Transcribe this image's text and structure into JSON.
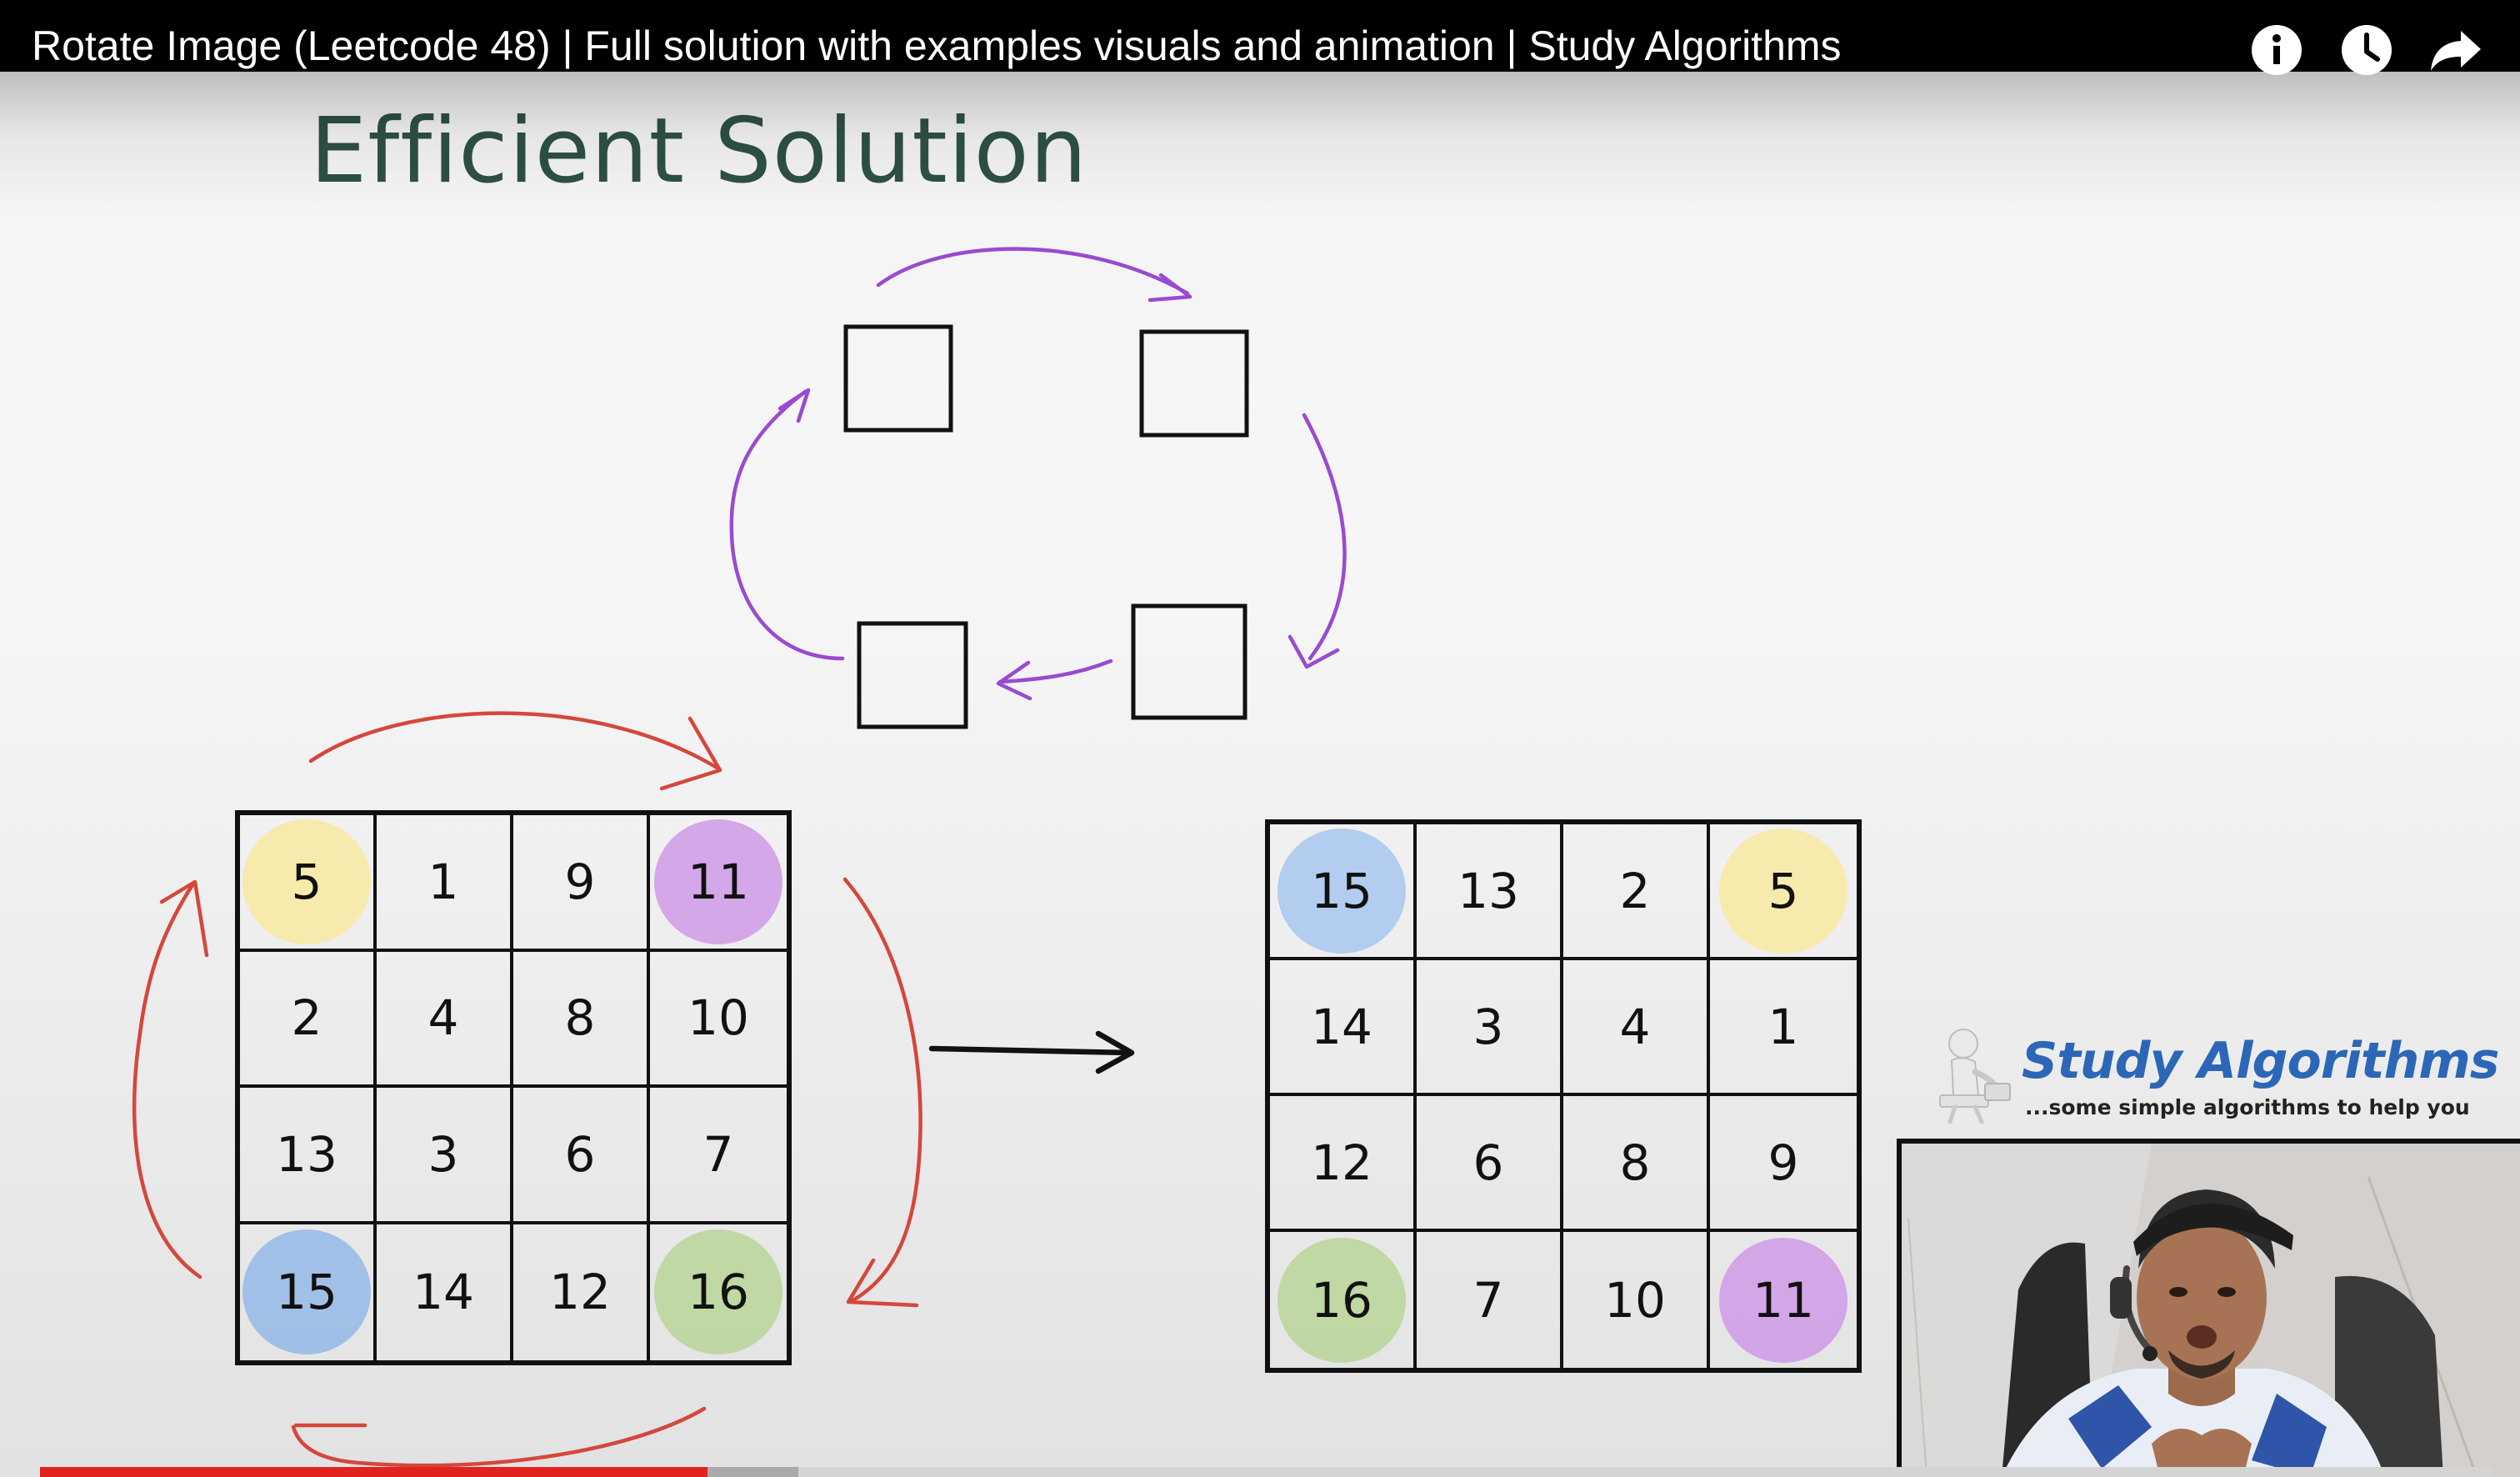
{
  "video": {
    "title": "Rotate Image (Leetcode 48) | Full solution with examples visuals and animation | Study Algorithms",
    "progress": 0.272,
    "buffered": 0.309,
    "played_color": "#e0231e",
    "buffered_color": "#a9a9a9",
    "unplayed_color": "#d4d4d4"
  },
  "controls": {
    "info_icon": "info-icon",
    "watch_later_icon": "clock-icon",
    "share_icon": "share-arrow-icon"
  },
  "slide": {
    "title": "Efficient Solution",
    "title_color": "#2e5145",
    "arrow_colors": {
      "top_cycle": "#9a4ad1",
      "matrix_cycle": "#d5473b",
      "transform_arrow": "#111111"
    },
    "original_matrix": [
      [
        {
          "value": "5",
          "highlight": "#f8e9a1"
        },
        {
          "value": "1"
        },
        {
          "value": "9"
        },
        {
          "value": "11",
          "highlight": "#cf9ae6"
        }
      ],
      [
        {
          "value": "2"
        },
        {
          "value": "4"
        },
        {
          "value": "8"
        },
        {
          "value": "10"
        }
      ],
      [
        {
          "value": "13"
        },
        {
          "value": "3"
        },
        {
          "value": "6"
        },
        {
          "value": "7"
        }
      ],
      [
        {
          "value": "15",
          "highlight": "#94b9e6"
        },
        {
          "value": "14"
        },
        {
          "value": "12"
        },
        {
          "value": "16",
          "highlight": "#b8d596"
        }
      ]
    ],
    "rotated_matrix": [
      [
        {
          "value": "15",
          "highlight": "#a7c7ef"
        },
        {
          "value": "13"
        },
        {
          "value": "2"
        },
        {
          "value": "5",
          "highlight": "#f8e9a1"
        }
      ],
      [
        {
          "value": "14"
        },
        {
          "value": "3"
        },
        {
          "value": "4"
        },
        {
          "value": "1"
        }
      ],
      [
        {
          "value": "12"
        },
        {
          "value": "6"
        },
        {
          "value": "8"
        },
        {
          "value": "9"
        }
      ],
      [
        {
          "value": "16",
          "highlight": "#b8d596"
        },
        {
          "value": "7"
        },
        {
          "value": "10"
        },
        {
          "value": "11",
          "highlight": "#cf9ae6"
        }
      ]
    ]
  },
  "brand": {
    "name": "Study Algorithms",
    "tagline": "...some simple algorithms to help you",
    "name_color": "#2b67b6"
  }
}
